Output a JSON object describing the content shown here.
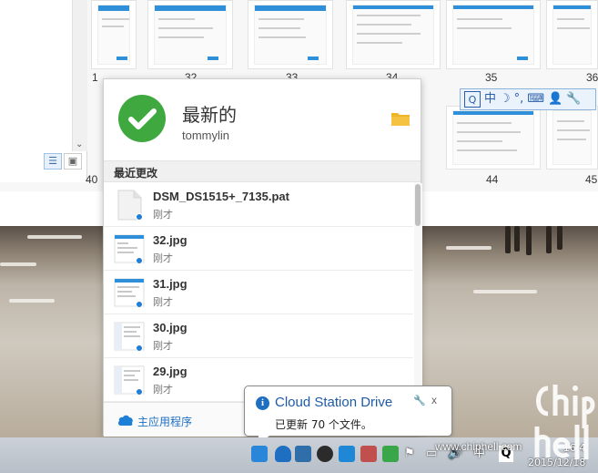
{
  "explorer": {
    "thumb_labels": [
      "32",
      "33",
      "34",
      "35",
      "36",
      "44",
      "45"
    ],
    "partial_labels": [
      "1",
      "40"
    ]
  },
  "ime": {
    "items": [
      "中",
      "☽",
      "°,",
      "⌨",
      "👤",
      "🔧"
    ]
  },
  "popup": {
    "status_title": "最新的",
    "username": "tommylin",
    "section_title": "最近更改",
    "files": [
      {
        "name": "DSM_DS1515+_7135.pat",
        "time": "刚才",
        "type": "file"
      },
      {
        "name": "32.jpg",
        "time": "刚才",
        "type": "image"
      },
      {
        "name": "31.jpg",
        "time": "刚才",
        "type": "image"
      },
      {
        "name": "30.jpg",
        "time": "刚才",
        "type": "image"
      },
      {
        "name": "29.jpg",
        "time": "刚才",
        "type": "image"
      }
    ],
    "footer_label": "主应用程序"
  },
  "balloon": {
    "title": "Cloud Station Drive",
    "message": "已更新 70 个文件。",
    "close": "x"
  },
  "taskbar": {
    "ime_indicator": "中",
    "clock_time": "16:4",
    "clock_date": "2015/12/18"
  },
  "watermark": {
    "url": "www.chiphell.com",
    "logo_text": "chiphell"
  },
  "colors": {
    "accent": "#1e7fd6",
    "success": "#3fa83f",
    "folder": "#f0b429"
  }
}
